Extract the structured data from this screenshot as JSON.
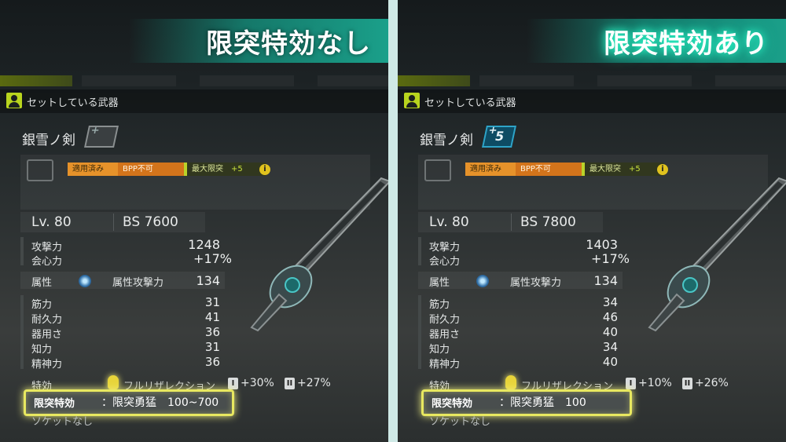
{
  "left": {
    "title": "限突特効なし",
    "header": "セットしている武器",
    "weapon_name": "銀雪ノ剣",
    "plate_number": "",
    "badges": {
      "applied": "適用済み",
      "bpp": "BPP不可",
      "max_limit": "最大限突",
      "max_limit_plus": "+5"
    },
    "level_label": "Lv.",
    "level": "80",
    "bs_label": "BS",
    "bs": "7600",
    "attack_label": "攻撃力",
    "attack": "1248",
    "crit_label": "会心力",
    "crit": "+17%",
    "element_label": "属性",
    "element_attack_label": "属性攻撃力",
    "element_attack": "134",
    "str_label": "筋力",
    "str": "31",
    "vit_label": "耐久力",
    "vit": "41",
    "dex_label": "器用さ",
    "dex": "36",
    "int_label": "知力",
    "int": "31",
    "mnd_label": "精神力",
    "mnd": "36",
    "special_label": "特効",
    "special_name": "フルリザレクション",
    "special_1": "+30%",
    "special_2": "+27%",
    "limit_label": "限突特効",
    "limit_value": "：限突勇猛　100~700",
    "socket": "ソケットなし"
  },
  "right": {
    "title": "限突特効あり",
    "header": "セットしている武器",
    "weapon_name": "銀雪ノ剣",
    "plate_number": "5",
    "badges": {
      "applied": "適用済み",
      "bpp": "BPP不可",
      "max_limit": "最大限突",
      "max_limit_plus": "+5"
    },
    "level_label": "Lv.",
    "level": "80",
    "bs_label": "BS",
    "bs": "7800",
    "attack_label": "攻撃力",
    "attack": "1403",
    "crit_label": "会心力",
    "crit": "+17%",
    "element_label": "属性",
    "element_attack_label": "属性攻撃力",
    "element_attack": "134",
    "str_label": "筋力",
    "str": "34",
    "vit_label": "耐久力",
    "vit": "46",
    "dex_label": "器用さ",
    "dex": "40",
    "int_label": "知力",
    "int": "34",
    "mnd_label": "精神力",
    "mnd": "40",
    "special_label": "特効",
    "special_name": "フルリザレクション",
    "special_1": "+10%",
    "special_2": "+26%",
    "limit_label": "限突特効",
    "limit_value": "：限突勇猛　100",
    "socket": "ソケットなし"
  },
  "icons": {
    "header": "person-icon",
    "element": "ice-element-icon",
    "info": "info-icon",
    "roman_1": "I",
    "roman_2": "II"
  },
  "colors": {
    "accent": "#1aa08a",
    "highlight": "#e8e860",
    "badge_orange": "#e6922a",
    "limit_green": "#b9d32a"
  }
}
